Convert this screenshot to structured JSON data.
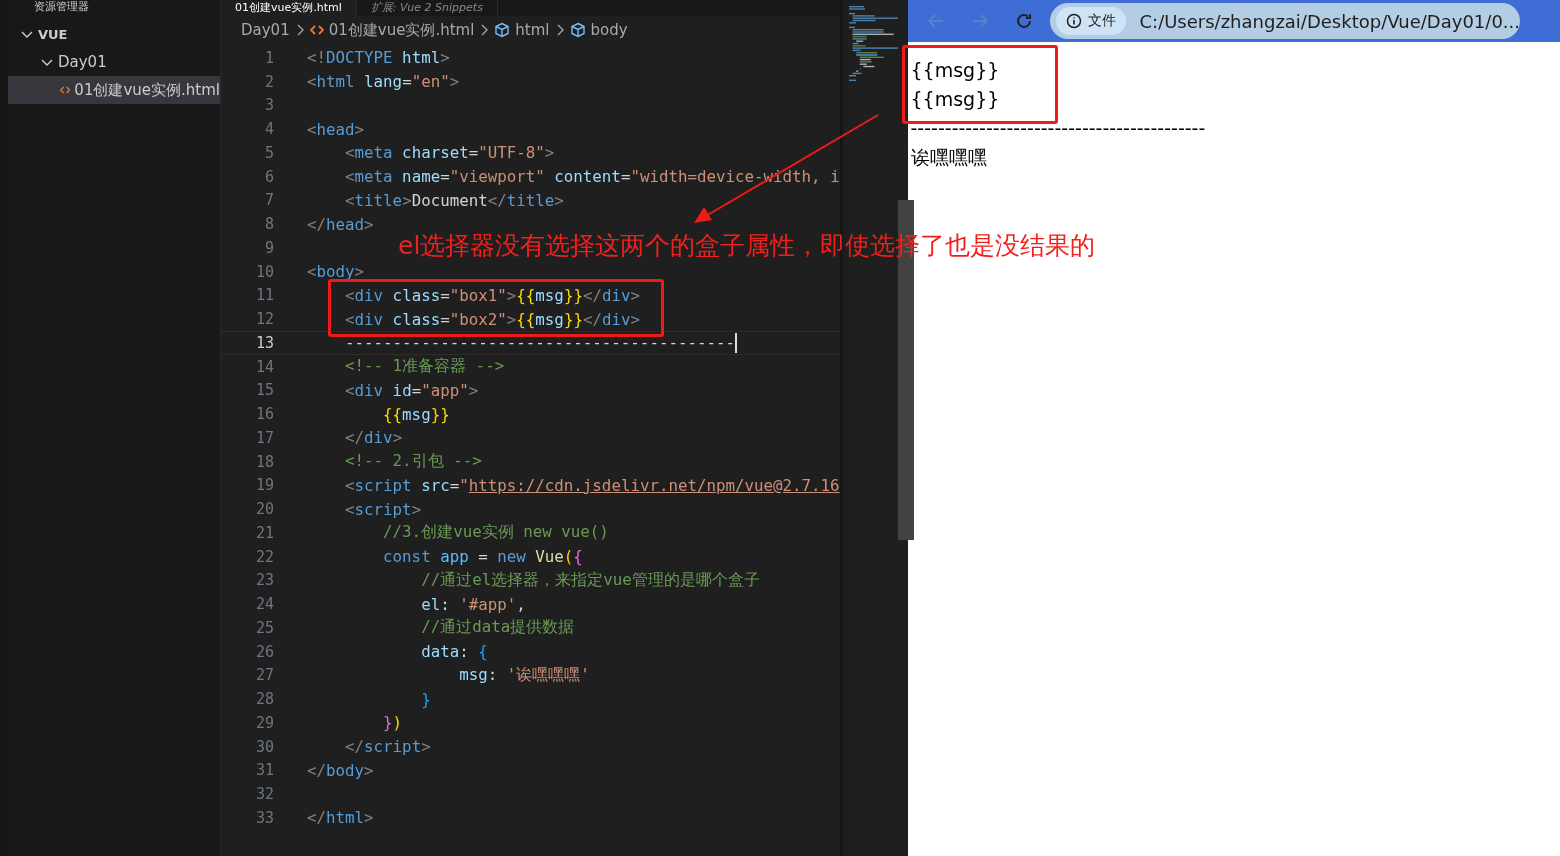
{
  "explorer": {
    "title": "资源管理器",
    "root": {
      "label": "VUE",
      "expanded": true,
      "children": [
        {
          "label": "Day01",
          "expanded": true,
          "children": [
            {
              "label": "01创建vue实例.html",
              "selected": true
            }
          ]
        }
      ]
    }
  },
  "tabs": [
    {
      "label": "01创建vue实例.html",
      "selected": true
    },
    {
      "label": "扩展: Vue 2 Snippets",
      "selected": false
    }
  ],
  "breadcrumbs": [
    {
      "label": "Day01",
      "kind": "folder"
    },
    {
      "label": "01创建vue实例.html",
      "kind": "file"
    },
    {
      "label": "html",
      "kind": "element"
    },
    {
      "label": "body",
      "kind": "element"
    }
  ],
  "editor": {
    "lines": [
      {
        "number": "1",
        "current": false,
        "tokens": [
          {
            "kind": "punct",
            "text": "<!"
          },
          {
            "kind": "tag",
            "text": "DOCTYPE"
          },
          {
            "kind": "attr",
            "text": " html"
          },
          {
            "kind": "punct",
            "text": ">"
          }
        ]
      },
      {
        "number": "2",
        "current": false,
        "tokens": [
          {
            "kind": "punct",
            "text": "<"
          },
          {
            "kind": "tag",
            "text": "html"
          },
          {
            "kind": "attr",
            "text": " lang"
          },
          {
            "kind": "text",
            "text": "="
          },
          {
            "kind": "string",
            "text": "\"en\""
          },
          {
            "kind": "punct",
            "text": ">"
          }
        ]
      },
      {
        "number": "3",
        "current": false
      },
      {
        "number": "4",
        "current": false,
        "tokens": [
          {
            "kind": "punct",
            "text": "<"
          },
          {
            "kind": "tag",
            "text": "head"
          },
          {
            "kind": "punct",
            "text": ">"
          }
        ]
      },
      {
        "number": "5",
        "current": false,
        "tokens": [
          {
            "kind": "punct",
            "text": "    <"
          },
          {
            "kind": "tag",
            "text": "meta"
          },
          {
            "kind": "attr",
            "text": " charset"
          },
          {
            "kind": "text",
            "text": "="
          },
          {
            "kind": "string",
            "text": "\"UTF-8\""
          },
          {
            "kind": "punct",
            "text": ">"
          }
        ]
      },
      {
        "number": "6",
        "current": false,
        "tokens": [
          {
            "kind": "punct",
            "text": "    <"
          },
          {
            "kind": "tag",
            "text": "meta"
          },
          {
            "kind": "attr",
            "text": " name"
          },
          {
            "kind": "text",
            "text": "="
          },
          {
            "kind": "string",
            "text": "\"viewport\""
          },
          {
            "kind": "attr",
            "text": " content"
          },
          {
            "kind": "text",
            "text": "="
          },
          {
            "kind": "string",
            "text": "\"width=device-width, i"
          }
        ]
      },
      {
        "number": "7",
        "current": false,
        "tokens": [
          {
            "kind": "punct",
            "text": "    <"
          },
          {
            "kind": "tag",
            "text": "title"
          },
          {
            "kind": "punct",
            "text": ">"
          },
          {
            "kind": "text",
            "text": "Document"
          },
          {
            "kind": "punct",
            "text": "</"
          },
          {
            "kind": "tag",
            "text": "title"
          },
          {
            "kind": "punct",
            "text": ">"
          }
        ]
      },
      {
        "number": "8",
        "current": false,
        "tokens": [
          {
            "kind": "punct",
            "text": "</"
          },
          {
            "kind": "tag",
            "text": "head"
          },
          {
            "kind": "punct",
            "text": ">"
          }
        ]
      },
      {
        "number": "9",
        "current": false
      },
      {
        "number": "10",
        "current": false,
        "tokens": [
          {
            "kind": "punct",
            "text": "<"
          },
          {
            "kind": "tag",
            "text": "body"
          },
          {
            "kind": "punct",
            "text": ">"
          }
        ]
      },
      {
        "number": "11",
        "current": false,
        "tokens": [
          {
            "kind": "punct",
            "text": "    <"
          },
          {
            "kind": "tag",
            "text": "div"
          },
          {
            "kind": "attr",
            "text": " class"
          },
          {
            "kind": "text",
            "text": "="
          },
          {
            "kind": "string",
            "text": "\"box1\""
          },
          {
            "kind": "punct",
            "text": ">"
          },
          {
            "kind": "brace1",
            "text": "{{"
          },
          {
            "kind": "attr",
            "text": "msg"
          },
          {
            "kind": "brace1",
            "text": "}}"
          },
          {
            "kind": "punct",
            "text": "</"
          },
          {
            "kind": "tag",
            "text": "div"
          },
          {
            "kind": "punct",
            "text": ">"
          }
        ]
      },
      {
        "number": "12",
        "current": false,
        "tokens": [
          {
            "kind": "punct",
            "text": "    <"
          },
          {
            "kind": "tag",
            "text": "div"
          },
          {
            "kind": "attr",
            "text": " class"
          },
          {
            "kind": "text",
            "text": "="
          },
          {
            "kind": "string",
            "text": "\"box2\""
          },
          {
            "kind": "punct",
            "text": ">"
          },
          {
            "kind": "brace1",
            "text": "{{"
          },
          {
            "kind": "attr",
            "text": "msg"
          },
          {
            "kind": "brace1",
            "text": "}}"
          },
          {
            "kind": "punct",
            "text": "</"
          },
          {
            "kind": "tag",
            "text": "div"
          },
          {
            "kind": "punct",
            "text": ">"
          }
        ]
      },
      {
        "number": "13",
        "current": true,
        "tokens": [
          {
            "kind": "text",
            "text": "    -----------------------------------------"
          }
        ]
      },
      {
        "number": "14",
        "current": false,
        "tokens": [
          {
            "kind": "comment",
            "text": "    <!-- 1准备容器 -->"
          }
        ]
      },
      {
        "number": "15",
        "current": false,
        "tokens": [
          {
            "kind": "punct",
            "text": "    <"
          },
          {
            "kind": "tag",
            "text": "div"
          },
          {
            "kind": "attr",
            "text": " id"
          },
          {
            "kind": "text",
            "text": "="
          },
          {
            "kind": "string",
            "text": "\"app\""
          },
          {
            "kind": "punct",
            "text": ">"
          }
        ]
      },
      {
        "number": "16",
        "current": false,
        "tokens": [
          {
            "kind": "brace1",
            "text": "        {{"
          },
          {
            "kind": "attr",
            "text": "msg"
          },
          {
            "kind": "brace1",
            "text": "}}"
          }
        ]
      },
      {
        "number": "17",
        "current": false,
        "tokens": [
          {
            "kind": "punct",
            "text": "    </"
          },
          {
            "kind": "tag",
            "text": "div"
          },
          {
            "kind": "punct",
            "text": ">"
          }
        ]
      },
      {
        "number": "18",
        "current": false,
        "tokens": [
          {
            "kind": "comment",
            "text": "    <!-- 2.引包 -->"
          }
        ]
      },
      {
        "number": "19",
        "current": false,
        "tokens": [
          {
            "kind": "punct",
            "text": "    <"
          },
          {
            "kind": "tag",
            "text": "script"
          },
          {
            "kind": "attr",
            "text": " src"
          },
          {
            "kind": "text",
            "text": "="
          },
          {
            "kind": "string",
            "text": "\""
          },
          {
            "kind": "link",
            "text": "https://cdn.jsdelivr.net/npm/vue@2.7.16"
          }
        ]
      },
      {
        "number": "20",
        "current": false,
        "tokens": [
          {
            "kind": "punct",
            "text": "    <"
          },
          {
            "kind": "tag",
            "text": "script"
          },
          {
            "kind": "punct",
            "text": ">"
          }
        ]
      },
      {
        "number": "21",
        "current": false,
        "tokens": [
          {
            "kind": "comment",
            "text": "        //3.创建vue实例 new vue()"
          }
        ]
      },
      {
        "number": "22",
        "current": false,
        "tokens": [
          {
            "kind": "keyword",
            "text": "        const"
          },
          {
            "kind": "var",
            "text": " app"
          },
          {
            "kind": "text",
            "text": " = "
          },
          {
            "kind": "keyword",
            "text": "new"
          },
          {
            "kind": "class",
            "text": " Vue"
          },
          {
            "kind": "brace1",
            "text": "("
          },
          {
            "kind": "brace2",
            "text": "{"
          }
        ]
      },
      {
        "number": "23",
        "current": false,
        "tokens": [
          {
            "kind": "comment",
            "text": "            //通过el选择器，来指定vue管理的是哪个盒子"
          }
        ]
      },
      {
        "number": "24",
        "current": false,
        "tokens": [
          {
            "kind": "attr",
            "text": "            el"
          },
          {
            "kind": "text",
            "text": ": "
          },
          {
            "kind": "string",
            "text": "'#app'"
          },
          {
            "kind": "text",
            "text": ","
          }
        ]
      },
      {
        "number": "25",
        "current": false,
        "tokens": [
          {
            "kind": "comment",
            "text": "            //通过data提供数据"
          }
        ]
      },
      {
        "number": "26",
        "current": false,
        "tokens": [
          {
            "kind": "attr",
            "text": "            data"
          },
          {
            "kind": "text",
            "text": ": "
          },
          {
            "kind": "brace3",
            "text": "{"
          }
        ]
      },
      {
        "number": "27",
        "current": false,
        "tokens": [
          {
            "kind": "attr",
            "text": "                msg"
          },
          {
            "kind": "text",
            "text": ": "
          },
          {
            "kind": "string",
            "text": "'诶嘿嘿嘿'"
          }
        ]
      },
      {
        "number": "28",
        "current": false,
        "tokens": [
          {
            "kind": "brace3",
            "text": "            }"
          }
        ]
      },
      {
        "number": "29",
        "current": false,
        "tokens": [
          {
            "kind": "brace2",
            "text": "        }"
          },
          {
            "kind": "brace1",
            "text": ")"
          }
        ]
      },
      {
        "number": "30",
        "current": false,
        "tokens": [
          {
            "kind": "punct",
            "text": "    </"
          },
          {
            "kind": "tag",
            "text": "script"
          },
          {
            "kind": "punct",
            "text": ">"
          }
        ]
      },
      {
        "number": "31",
        "current": false,
        "tokens": [
          {
            "kind": "punct",
            "text": "</"
          },
          {
            "kind": "tag",
            "text": "body"
          },
          {
            "kind": "punct",
            "text": ">"
          }
        ]
      },
      {
        "number": "32",
        "current": false
      },
      {
        "number": "33",
        "current": false,
        "tokens": [
          {
            "kind": "punct",
            "text": "</"
          },
          {
            "kind": "tag",
            "text": "html"
          },
          {
            "kind": "punct",
            "text": ">"
          }
        ]
      }
    ]
  },
  "browser": {
    "site_info": "文件",
    "address": "C:/Users/zhangzai/Desktop/Vue/Day01/0...",
    "content": [
      {
        "text": "{{msg}}"
      },
      {
        "text": "{{msg}}"
      },
      {
        "text": "-------------------------------------------"
      },
      {
        "text": "诶嘿嘿嘿"
      }
    ]
  },
  "annotation": {
    "text": "el选择器没有选择这两个的盒子属性，即使选择了也是没结果的"
  }
}
